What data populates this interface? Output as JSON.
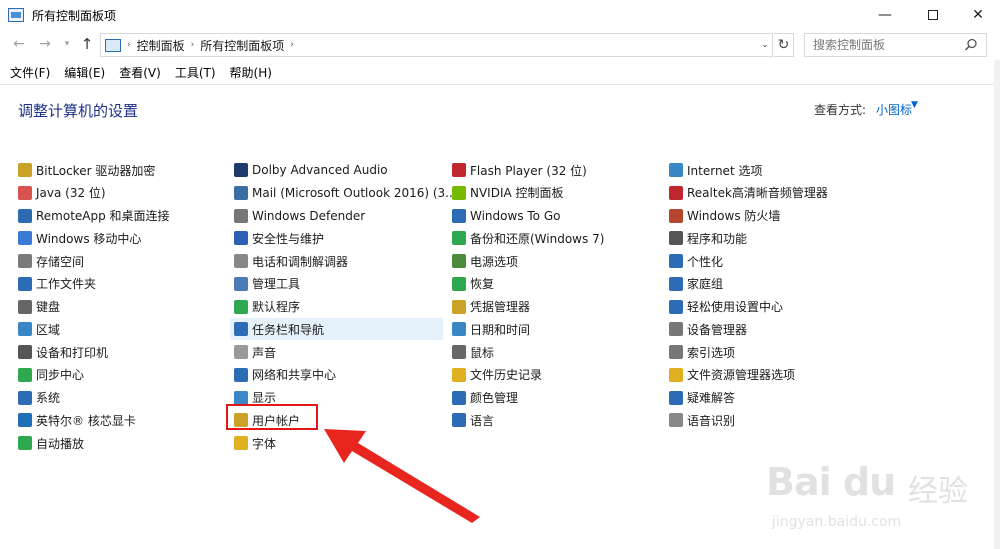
{
  "window": {
    "title": "所有控制面板项",
    "minimize_label": "—",
    "close_label": "✕"
  },
  "nav": {
    "back": "←",
    "forward": "→",
    "history": "▾",
    "up": "↑",
    "breadcrumb": [
      "控制面板",
      "所有控制面板项"
    ],
    "breadcrumb_sep": "›",
    "dropdown": "⌄",
    "refresh": "↻",
    "search_placeholder": "搜索控制面板"
  },
  "menubar": [
    "文件(F)",
    "编辑(E)",
    "查看(V)",
    "工具(T)",
    "帮助(H)"
  ],
  "content": {
    "heading": "调整计算机的设置",
    "view_by_label": "查看方式:",
    "view_by_value": "小图标",
    "view_by_caret": "▼"
  },
  "columns": [
    [
      {
        "label": "BitLocker 驱动器加密",
        "icon": "bitlocker-icon",
        "color": "#c9a227"
      },
      {
        "label": "Java (32 位)",
        "icon": "java-icon",
        "color": "#d9534f"
      },
      {
        "label": "RemoteApp 和桌面连接",
        "icon": "remoteapp-icon",
        "color": "#2d6bb5"
      },
      {
        "label": "Windows 移动中心",
        "icon": "mobility-center-icon",
        "color": "#3a7bd5"
      },
      {
        "label": "存储空间",
        "icon": "storage-spaces-icon",
        "color": "#7a7a7a"
      },
      {
        "label": "工作文件夹",
        "icon": "work-folders-icon",
        "color": "#2d6bb5"
      },
      {
        "label": "键盘",
        "icon": "keyboard-icon",
        "color": "#666666"
      },
      {
        "label": "区域",
        "icon": "region-icon",
        "color": "#3a87c8"
      },
      {
        "label": "设备和打印机",
        "icon": "devices-printers-icon",
        "color": "#555555"
      },
      {
        "label": "同步中心",
        "icon": "sync-center-icon",
        "color": "#2fa84f"
      },
      {
        "label": "系统",
        "icon": "system-icon",
        "color": "#2d6bb5"
      },
      {
        "label": "英特尔® 核芯显卡",
        "icon": "intel-graphics-icon",
        "color": "#1f6fb8"
      },
      {
        "label": "自动播放",
        "icon": "autoplay-icon",
        "color": "#2fa84f"
      }
    ],
    [
      {
        "label": "Dolby Advanced Audio",
        "icon": "dolby-icon",
        "color": "#1e3a6b"
      },
      {
        "label": "Mail (Microsoft Outlook 2016) (3...",
        "icon": "mail-icon",
        "color": "#3a6ea5"
      },
      {
        "label": "Windows Defender",
        "icon": "defender-icon",
        "color": "#777777"
      },
      {
        "label": "安全性与维护",
        "icon": "security-maintenance-icon",
        "color": "#2d5fb5"
      },
      {
        "label": "电话和调制解调器",
        "icon": "phone-modem-icon",
        "color": "#888888"
      },
      {
        "label": "管理工具",
        "icon": "admin-tools-icon",
        "color": "#4a7bb8"
      },
      {
        "label": "默认程序",
        "icon": "default-programs-icon",
        "color": "#2fa84f"
      },
      {
        "label": "任务栏和导航",
        "icon": "taskbar-icon",
        "color": "#2d6bb5"
      },
      {
        "label": "声音",
        "icon": "sound-icon",
        "color": "#9a9a9a"
      },
      {
        "label": "网络和共享中心",
        "icon": "network-sharing-icon",
        "color": "#2d6bb5"
      },
      {
        "label": "显示",
        "icon": "display-icon",
        "color": "#3a87c8"
      },
      {
        "label": "用户帐户",
        "icon": "user-accounts-icon",
        "color": "#c9a227"
      },
      {
        "label": "字体",
        "icon": "fonts-icon",
        "color": "#e0b020"
      }
    ],
    [
      {
        "label": "Flash Player (32 位)",
        "icon": "flash-icon",
        "color": "#c0262d"
      },
      {
        "label": "NVIDIA 控制面板",
        "icon": "nvidia-icon",
        "color": "#76b900"
      },
      {
        "label": "Windows To Go",
        "icon": "windows-to-go-icon",
        "color": "#2d6bb5"
      },
      {
        "label": "备份和还原(Windows 7)",
        "icon": "backup-restore-icon",
        "color": "#2fa84f"
      },
      {
        "label": "电源选项",
        "icon": "power-options-icon",
        "color": "#4a8a3a"
      },
      {
        "label": "恢复",
        "icon": "recovery-icon",
        "color": "#2fa84f"
      },
      {
        "label": "凭据管理器",
        "icon": "credential-manager-icon",
        "color": "#c9a227"
      },
      {
        "label": "日期和时间",
        "icon": "date-time-icon",
        "color": "#3a87c8"
      },
      {
        "label": "鼠标",
        "icon": "mouse-icon",
        "color": "#666666"
      },
      {
        "label": "文件历史记录",
        "icon": "file-history-icon",
        "color": "#e0b020"
      },
      {
        "label": "颜色管理",
        "icon": "color-management-icon",
        "color": "#2d6bb5"
      },
      {
        "label": "语言",
        "icon": "language-icon",
        "color": "#2d6bb5"
      }
    ],
    [
      {
        "label": "Internet 选项",
        "icon": "internet-options-icon",
        "color": "#3a87c8"
      },
      {
        "label": "Realtek高清晰音频管理器",
        "icon": "realtek-icon",
        "color": "#c0262d"
      },
      {
        "label": "Windows 防火墙",
        "icon": "firewall-icon",
        "color": "#b5452d"
      },
      {
        "label": "程序和功能",
        "icon": "programs-features-icon",
        "color": "#555555"
      },
      {
        "label": "个性化",
        "icon": "personalization-icon",
        "color": "#2d6bb5"
      },
      {
        "label": "家庭组",
        "icon": "homegroup-icon",
        "color": "#2d6bb5"
      },
      {
        "label": "轻松使用设置中心",
        "icon": "ease-of-access-icon",
        "color": "#2d6bb5"
      },
      {
        "label": "设备管理器",
        "icon": "device-manager-icon",
        "color": "#777777"
      },
      {
        "label": "索引选项",
        "icon": "indexing-options-icon",
        "color": "#777777"
      },
      {
        "label": "文件资源管理器选项",
        "icon": "explorer-options-icon",
        "color": "#e0b020"
      },
      {
        "label": "疑难解答",
        "icon": "troubleshooting-icon",
        "color": "#2d6bb5"
      },
      {
        "label": "语音识别",
        "icon": "speech-recognition-icon",
        "color": "#888888"
      }
    ]
  ],
  "watermark": {
    "brand": "Bai du",
    "name": "经验",
    "url": "jingyan.baidu.com"
  }
}
